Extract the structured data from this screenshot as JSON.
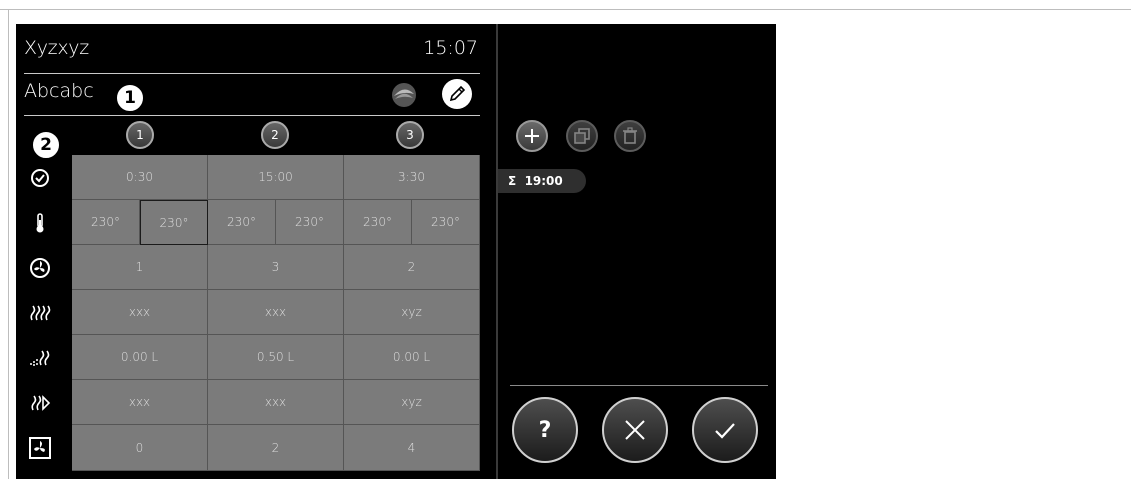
{
  "header": {
    "title": "Xyzxyz",
    "time": "15:07"
  },
  "program": {
    "name": "Abcabc"
  },
  "callouts": {
    "one": "1",
    "two": "2"
  },
  "steps": [
    "1",
    "2",
    "3"
  ],
  "rows": [
    {
      "icon": "clock-icon",
      "cells": [
        "0:30",
        "15:00",
        "3:30"
      ]
    },
    {
      "icon": "thermometer-icon",
      "cells": [
        "230°",
        "230°",
        "230°",
        "230°",
        "230°",
        "230°"
      ]
    },
    {
      "icon": "fan-icon",
      "cells": [
        "1",
        "3",
        "2"
      ]
    },
    {
      "icon": "heat-icon",
      "cells": [
        "xxx",
        "xxx",
        "xyz"
      ]
    },
    {
      "icon": "steam-icon",
      "cells": [
        "0.00 L",
        "0.50 L",
        "0.00 L"
      ]
    },
    {
      "icon": "heat-forward-icon",
      "cells": [
        "xxx",
        "xxx",
        "xyz"
      ]
    },
    {
      "icon": "fan-box-icon",
      "cells": [
        "0",
        "2",
        "4"
      ]
    }
  ],
  "summary": {
    "symbol": "Σ",
    "total": "19:00"
  },
  "actions": {
    "help_label": "?"
  },
  "colors": {
    "screen": "#000000",
    "cell": "#7b7b7b",
    "accent": "#ffffff"
  }
}
